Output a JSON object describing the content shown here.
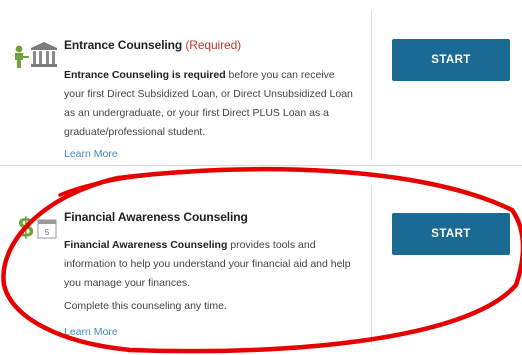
{
  "colors": {
    "accent": "#1a6a94",
    "required_text": "#c0392b",
    "link": "#3f8bbf",
    "icon_green": "#6fa339",
    "annotation_red": "#e60000"
  },
  "entrance": {
    "icon": "building-with-person-icon",
    "title": "Entrance Counseling",
    "required_tag": "(Required)",
    "desc_bold": "Entrance Counseling is required",
    "desc_rest": " before you can receive your first Direct Subsidized Loan, or Direct Unsubsidized Loan as an undergraduate, or your first Direct PLUS Loan as a graduate/professional student.",
    "learn_more": "Learn More",
    "start_label": "START"
  },
  "financial": {
    "icon": "dollar-calendar-icon",
    "calendar_day": "5",
    "title": "Financial Awareness Counseling",
    "desc_bold": "Financial Awareness Counseling",
    "desc_rest": " provides tools and information to help you understand your financial aid and help you manage your finances.",
    "extra": "Complete this counseling any time.",
    "learn_more": "Learn More",
    "start_label": "START"
  }
}
